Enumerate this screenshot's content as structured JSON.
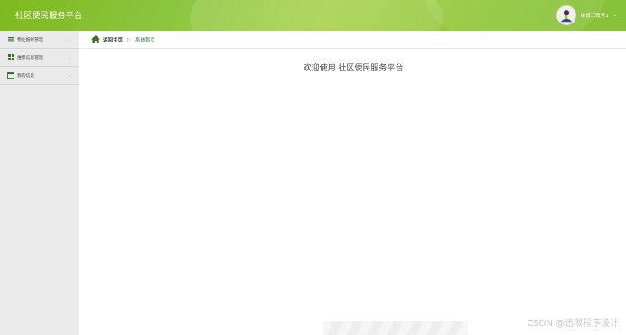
{
  "header": {
    "app_title": "社区便民服务平台",
    "user_name": "维修工账号1",
    "caret": "⌄",
    "accent_color": "#8cc63f"
  },
  "sidebar": {
    "items": [
      {
        "label": "物业报修管理",
        "icon": "list-icon",
        "chevron": "⌄"
      },
      {
        "label": "维修信息管理",
        "icon": "grid-icon",
        "chevron": "⌄"
      },
      {
        "label": "我的信息",
        "icon": "card-icon",
        "chevron": "⌄"
      }
    ]
  },
  "breadcrumb": {
    "home": "返回主页",
    "separator": "▷",
    "current": "系统首页"
  },
  "main": {
    "welcome": "欢迎使用 社区便民服务平台"
  },
  "watermark": "CSDN @迅限程序设计"
}
